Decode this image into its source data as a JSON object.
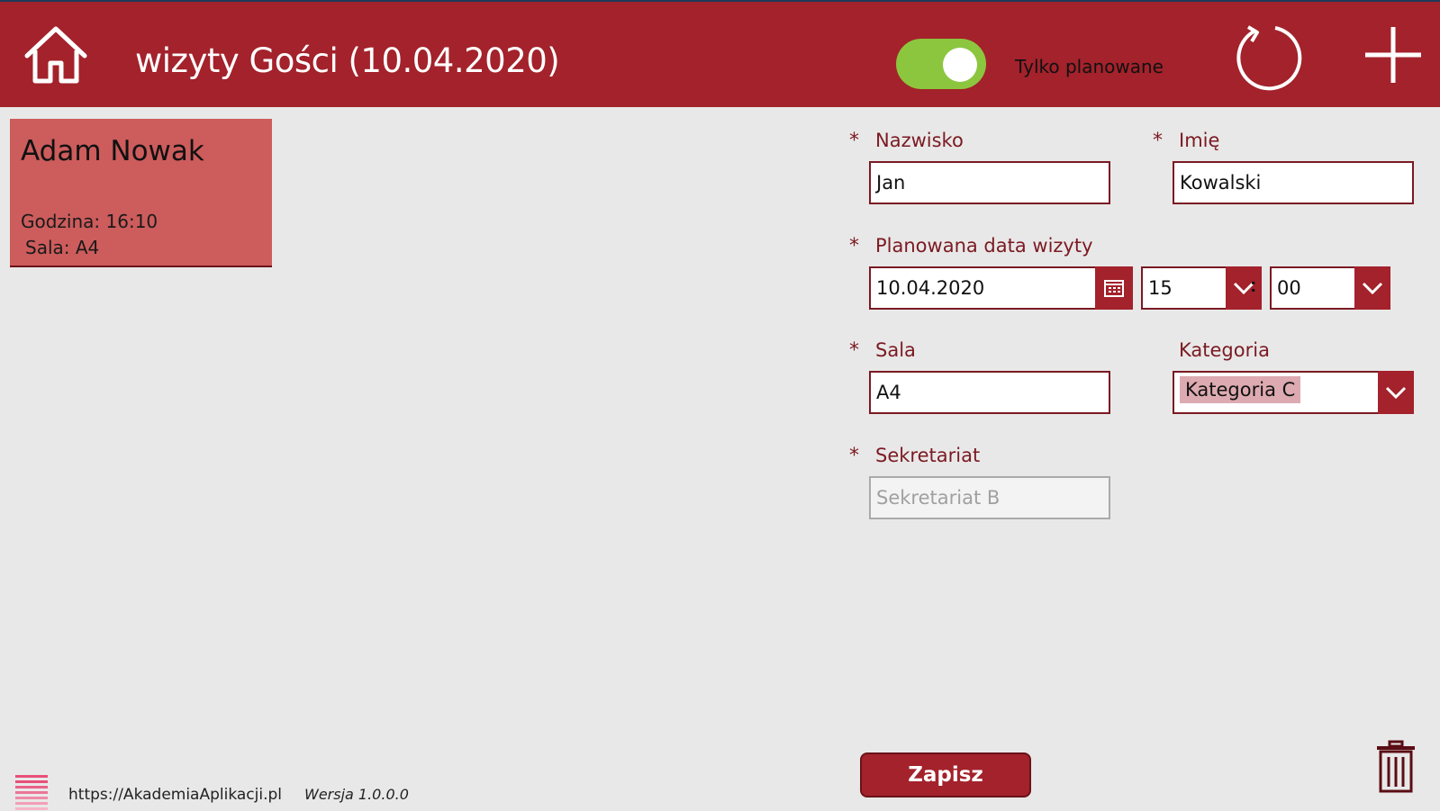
{
  "header": {
    "title": "wizyty Gości (10.04.2020)",
    "toggle_label": "Tylko planowane",
    "toggle_on": true,
    "home_icon": "home-icon",
    "refresh_icon": "refresh-icon",
    "add_icon": "plus-icon"
  },
  "visits": [
    {
      "name": "Adam Nowak",
      "time": "Godzina: 16:10",
      "room": "Sala: A4"
    }
  ],
  "form": {
    "required_mark": "*",
    "surname": {
      "label": "Nazwisko",
      "value": "Jan"
    },
    "firstname": {
      "label": "Imię",
      "value": "Kowalski"
    },
    "date": {
      "label": "Planowana data wizyty",
      "value": "10.04.2020",
      "hour": "15",
      "minute": "00",
      "separator": ":"
    },
    "room": {
      "label": "Sala",
      "value": "A4"
    },
    "category": {
      "label": "Kategoria",
      "value": "Kategoria C"
    },
    "secretariat": {
      "label": "Sekretariat",
      "value": "Sekretariat B"
    }
  },
  "actions": {
    "save_label": "Zapisz",
    "delete_icon": "trash-icon"
  },
  "footer": {
    "url": "https://AkademiaAplikacji.pl",
    "version": "Wersja 1.0.0.0"
  },
  "colors": {
    "header": "#a3222b",
    "card": "#cd5c5c",
    "toggle": "#8cc63f",
    "background": "#e9e8e8",
    "accent_dark": "#7a1a22"
  }
}
